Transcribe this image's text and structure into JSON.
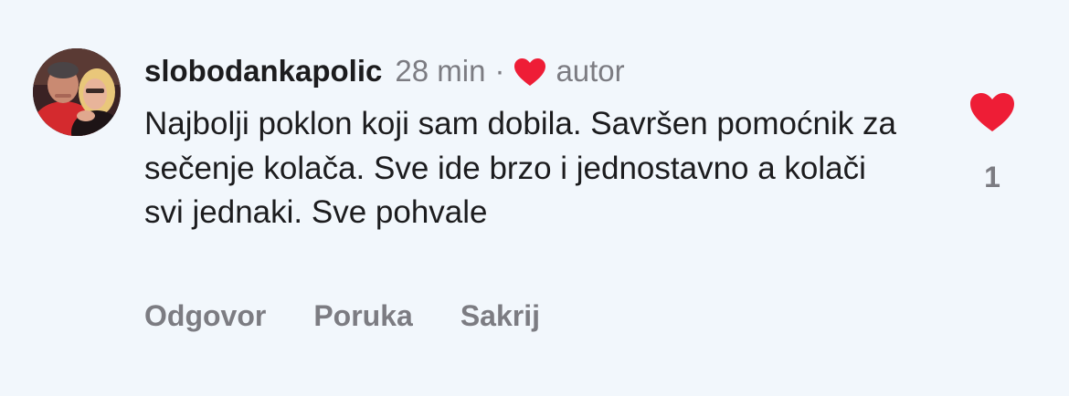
{
  "comment": {
    "username": "slobodankapolic",
    "time": "28 min",
    "separator": "·",
    "author_label": "autor",
    "author_liked_icon": "heart-icon",
    "text": "Najbolji poklon koji sam dobila. Savršen pomoćnik za sečenje kolača. Sve ide brzo i jednostavno a kolači svi jednaki. Sve pohvale",
    "like_icon": "heart-icon",
    "like_count": "1",
    "actions": {
      "reply": "Odgovor",
      "message": "Poruka",
      "hide": "Sakrij"
    }
  },
  "colors": {
    "background": "#f2f7fc",
    "text": "#1c1c1e",
    "secondary": "#7c7c82",
    "heart": "#ee1d36"
  }
}
